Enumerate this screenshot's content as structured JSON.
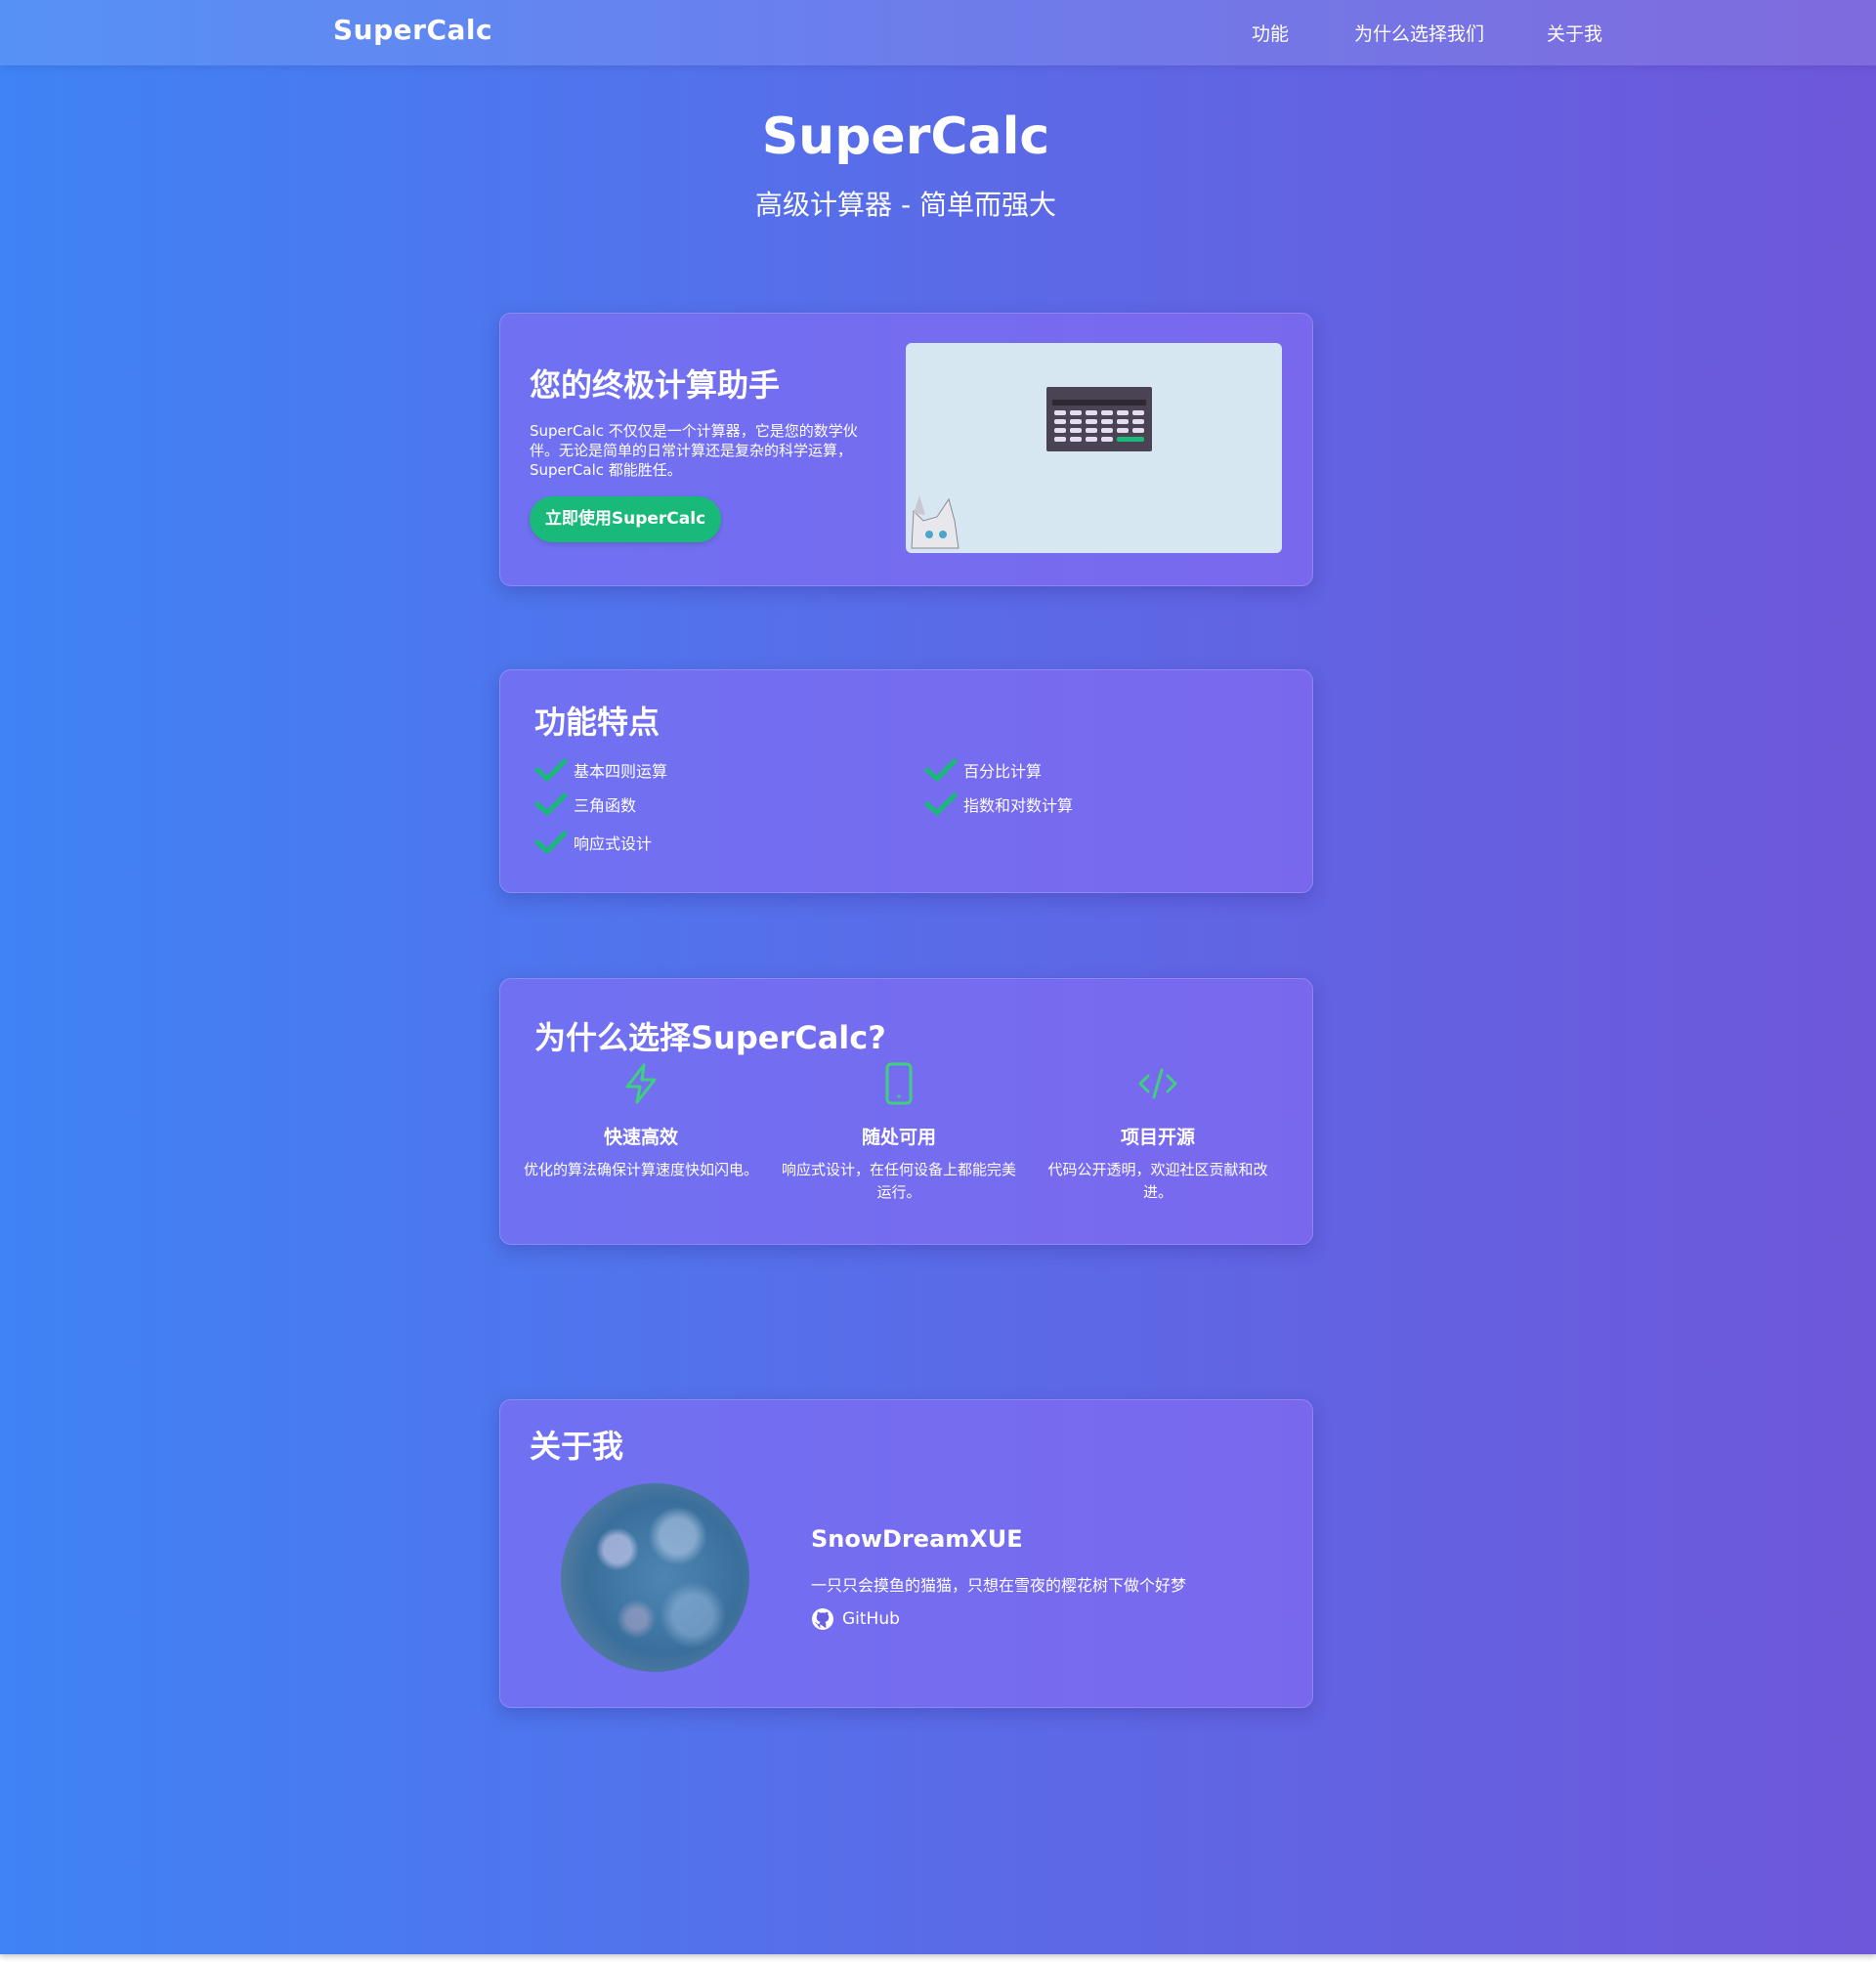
{
  "nav": {
    "brand": "SuperCalc",
    "links": [
      "功能",
      "为什么选择我们",
      "关于我"
    ]
  },
  "hero": {
    "title": "SuperCalc",
    "subtitle": "高级计算器 - 简单而强大"
  },
  "intro": {
    "title": "您的终极计算助手",
    "description": "SuperCalc 不仅仅是一个计算器，它是您的数学伙伴。无论是简单的日常计算还是复杂的科学运算，SuperCalc 都能胜任。",
    "cta_label": "立即使用SuperCalc"
  },
  "features": {
    "title": "功能特点",
    "items": [
      "基本四则运算",
      "百分比计算",
      "三角函数",
      "指数和对数计算",
      "响应式设计"
    ]
  },
  "why": {
    "title": "为什么选择SuperCalc?",
    "columns": [
      {
        "icon": "lightning-icon",
        "title": "快速高效",
        "desc": "优化的算法确保计算速度快如闪电。"
      },
      {
        "icon": "mobile-icon",
        "title": "随处可用",
        "desc": "响应式设计，在任何设备上都能完美运行。"
      },
      {
        "icon": "code-icon",
        "title": "项目开源",
        "desc": "代码公开透明，欢迎社区贡献和改进。"
      }
    ]
  },
  "about": {
    "title": "关于我",
    "name": "SnowDreamXUE",
    "bio": "一只只会摸鱼的猫猫，只想在雪夜的樱花树下做个好梦",
    "github_label": "GitHub"
  },
  "colors": {
    "accent": "#19b97a",
    "icon_green": "#3fd07f"
  }
}
